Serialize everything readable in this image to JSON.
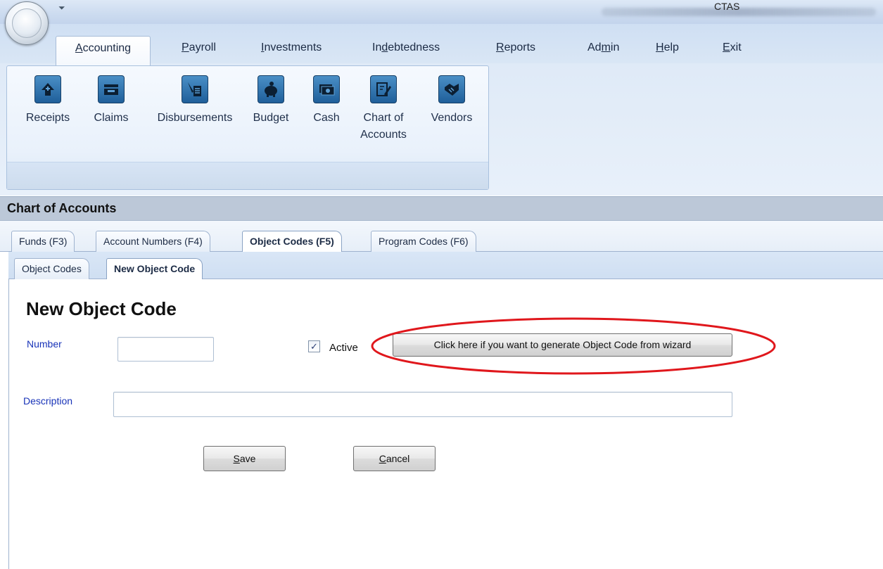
{
  "window": {
    "app_title": "CTAS"
  },
  "ribbon": {
    "tabs": [
      {
        "label": "Accounting",
        "accel": "A"
      },
      {
        "label": "Payroll",
        "accel": "P"
      },
      {
        "label": "Investments",
        "accel": "I"
      },
      {
        "label": "Indebtedness",
        "accel": "d"
      },
      {
        "label": "Reports",
        "accel": "R"
      },
      {
        "label": "Admin",
        "accel": "m"
      },
      {
        "label": "Help",
        "accel": "H"
      },
      {
        "label": "Exit",
        "accel": "E"
      }
    ],
    "active_tab": "Accounting",
    "buttons": [
      {
        "label": "Receipts",
        "icon": "receipt-arrow-icon"
      },
      {
        "label": "Claims",
        "icon": "inbox-tray-icon"
      },
      {
        "label": "Disbursements",
        "icon": "pen-ledger-icon"
      },
      {
        "label": "Budget",
        "icon": "piggy-bank-icon"
      },
      {
        "label": "Cash",
        "icon": "cash-bills-icon"
      },
      {
        "label": "Chart of",
        "label2": "Accounts",
        "icon": "document-edit-icon"
      },
      {
        "label": "Vendors",
        "icon": "handshake-icon"
      }
    ]
  },
  "header": {
    "title": "Chart of Accounts"
  },
  "doc_tabs": {
    "level1": [
      {
        "label": "Funds (F3)"
      },
      {
        "label": "Account Numbers (F4)"
      },
      {
        "label": "Object Codes (F5)"
      },
      {
        "label": "Program Codes (F6)"
      }
    ],
    "level1_active": "Object Codes (F5)",
    "level2": [
      {
        "label": "Object Codes"
      },
      {
        "label": "New Object Code"
      }
    ],
    "level2_active": "New Object Code"
  },
  "form": {
    "title": "New Object Code",
    "number_label": "Number",
    "number_value": "",
    "active_label": "Active",
    "active_checked": true,
    "wizard_button": "Click here if you want to generate Object Code from wizard",
    "description_label": "Description",
    "description_value": "",
    "save_label": "Save",
    "save_accel": "S",
    "cancel_label": "Cancel",
    "cancel_accel": "C"
  },
  "colors": {
    "field_label": "#1833b8",
    "highlight": "#e0171c",
    "ribbon_icon": "#1f5f9a"
  }
}
